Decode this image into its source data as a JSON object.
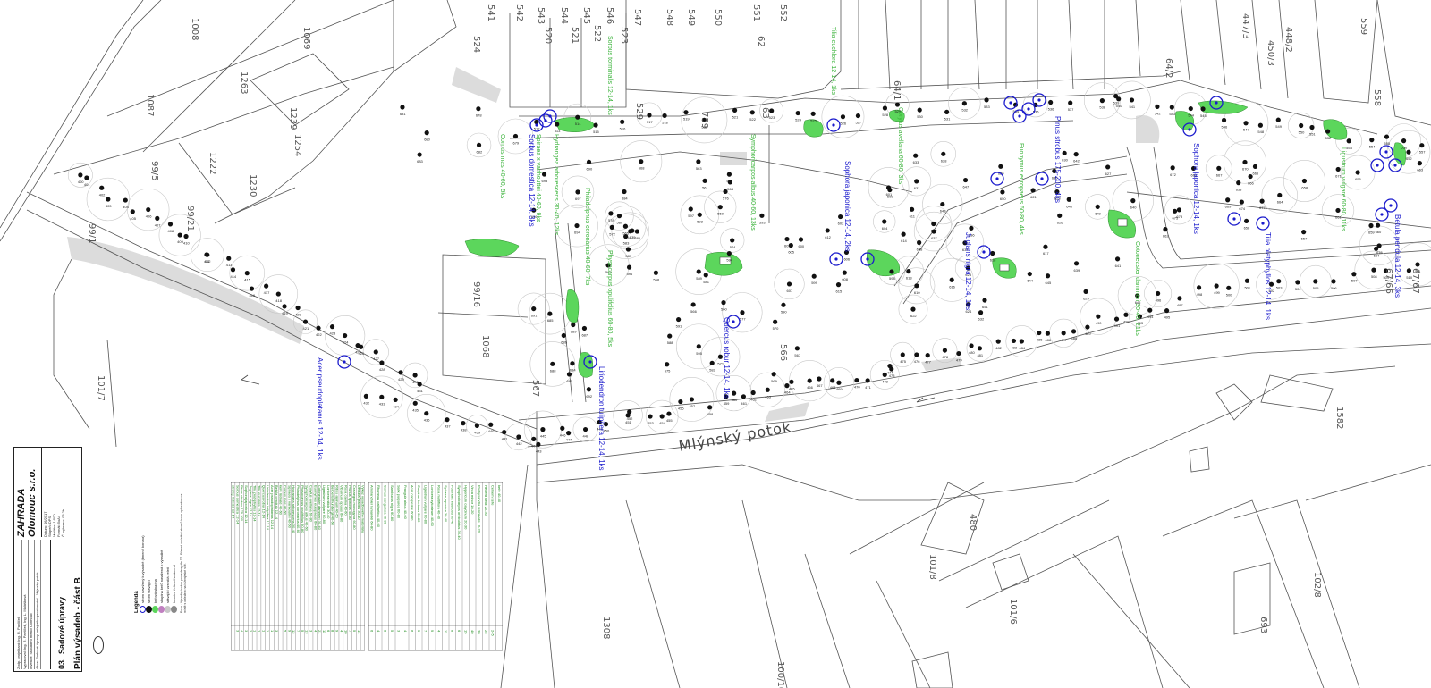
{
  "street_name": "Mlýnský potok",
  "parcels": [
    "541",
    "542",
    "543",
    "544",
    "545",
    "546",
    "547",
    "548",
    "549",
    "550",
    "551",
    "552",
    "559",
    "524",
    "520",
    "521",
    "522",
    "523",
    "529",
    "62",
    "63",
    "64/1",
    "64/2",
    "759",
    "67/66",
    "67/67",
    "99/5",
    "99/1",
    "99/21",
    "99/16",
    "1068",
    "567",
    "566",
    "1087",
    "1008",
    "1069",
    "1239",
    "1263",
    "1222",
    "1230",
    "1254",
    "1308",
    "101/7",
    "101/6",
    "100/10",
    "101/8",
    "102/8",
    "693",
    "480",
    "1582",
    "558",
    "450/3",
    "448/2",
    "447/3"
  ],
  "green_labels": [
    "Tilia euchlora 12-14, 1ks",
    "Sorbus torminalis 12-14, 1ks",
    "Cornus mas 40-60, 5ks",
    "Spiraea x vanhouttei 40-60, 9ks",
    "Hydrangea arborescens 30-40, 12ks",
    "Philadelphus coronarius 40-60, 7ks",
    "Physocarpus opulifolius 60-80, 5ks",
    "Symphoricarpos albus 40-60, 13ks",
    "Corylus avellana 60-80, 3ks",
    "Euonymus europaeus 60-80, 4ks",
    "Cotoneaster dammeri 30-40, 21ks",
    "Ligustrum vulgare 60-80, 11ks"
  ],
  "blue_labels": [
    "Sorbus domestica 12-14, 3ks",
    "Pinus strobus 175-200, 4ks",
    "Sophora japonica 12-14, 2ks",
    "Juglans nigra 12-14, 1ks",
    "Sophora japonica 12-14, 1ks",
    "Tilia platyphyllos 12-14, 1ks",
    "Quercus robur 12-14, 1ks",
    "Liriodendron tulipifera 12-14, 1ks",
    "Acer pseudoplatanus 12-14, 1ks",
    "Betula pendula 12-14, 3ks"
  ],
  "table1": {
    "header": "Výkaz výsadbového materiálu",
    "rows": [
      "stromy listnaté 12-14",
      "Sorbus domestica 12-14",
      "Pinus strobus 175-200",
      "Sophora japonica 12-14",
      "Juglans nigra 12-14",
      "Tilia platyphyllos 12-14",
      "Tilia euchlora 12-14",
      "Quercus robur 12-14",
      "Liriodendron tulipifera 12-14",
      "Acer pseudoplatanus 12-14",
      "Betula pendula 12-14",
      "keře listnaté 40-60",
      "Cornus mas 40-60",
      "Spiraea x vanhouttei 40-60",
      "Hydrangea arborescens 30-40",
      "Philadelphus coronarius 40-60",
      "Physocarpus opulifolius 60-80",
      "Symphoricarpos albus 40-60",
      "Corylus avellana 60-80",
      "Euonymus europaeus 60-80",
      "Cotoneaster dammeri 30-40",
      "Ligustrum vulgare 60-80",
      "Lonicera nitida 30-40",
      "Berberis thunbergii 40-60",
      "Ribes alpinum 40-60",
      "Viburnum opulus 60-80",
      "Rosa canina 40-60",
      "Prunus spinosa 40-60",
      "Crataegus monogyna 60-80",
      "Deutzia gracilis 30-40"
    ],
    "qty": [
      "",
      "3",
      "4",
      "3",
      "2",
      "1",
      "1",
      "1",
      "1",
      "1",
      "3",
      "",
      "5",
      "9",
      "12",
      "7",
      "5",
      "13",
      "3",
      "4",
      "21",
      "11",
      "6",
      "8",
      "9",
      "4",
      "10",
      "7",
      "5",
      "14"
    ]
  },
  "table2": {
    "header": "keře 40-60",
    "rows": [
      "Amelanchier lamarckii 60-80",
      "Rhamnus cathartica 40-60",
      "Cornus sanguinea 60-80",
      "Sambucus nigra 60-80",
      "Salix purpurea 60-80",
      "Frangula alnus 40-60",
      "Acer campestre 60-80",
      "Carpinus betulus 60-80",
      "Ligustrum vulgare 60-80",
      "Lonicera xylosteum 40-60",
      "Rosa multiflora 40-60",
      "Spiraea japonica 30-40",
      "Potentilla fruticosa 30-40",
      "Symphoricarpos orbiculatus 30-40",
      "Hypericum calycinum 20-30",
      "Vinca minor 10-20",
      "Pachysandra terminalis 10-20",
      "Hedera helix 20-30",
      "Celkem keře"
    ],
    "qty": [
      "6",
      "4",
      "8",
      "5",
      "3",
      "4",
      "6",
      "5",
      "7",
      "9",
      "4",
      "11",
      "8",
      "6",
      "15",
      "40",
      "30",
      "25",
      "245"
    ]
  },
  "legend": {
    "title": "Legenda",
    "items": [
      "strom navržený k výsadbě (kmen / koruna)",
      "strom stávající",
      "keřová skupina",
      "skupina keřů navržená k výsadbě",
      "stávající vzrostlá zeleň",
      "hranice řešeného území"
    ],
    "notes": "Pozn.: Výsadby budou provedeny dle TZ. Přesné umístění stromů bude upřesněno na místě s ohledem na inženýrské sítě."
  },
  "title_block": {
    "company": "ZAHRADA Olomouc s.r.o.",
    "rows": [
      {
        "label": "Zodp. projektant",
        "value": "Ing. R. Pavlíček"
      },
      {
        "label": "Vypracoval",
        "value": "Ing. R. Pavlíček, Ing. L. Malášková"
      },
      {
        "label": "Investor",
        "value": "Statutární město Olomouc"
      },
      {
        "label": "Akce",
        "value": "Parkové úpravy veřejného prostranství - Mlýnský potok"
      }
    ],
    "right": [
      {
        "label": "Datum",
        "value": "06/2017"
      },
      {
        "label": "Stupeň",
        "value": "DPS"
      },
      {
        "label": "Měřítko",
        "value": "1:500"
      },
      {
        "label": "Formát",
        "value": "5xA4"
      },
      {
        "label": "Č. výkresu",
        "value": "03.2b"
      }
    ],
    "drawing_no": "03.",
    "drawing_title": "Sadové úpravy",
    "drawing_subtitle": "Plán výsadeb - část B"
  },
  "colors": {
    "green": "#3bb33b",
    "blue": "#1a1acc",
    "shrub_fill": "#5cd65c",
    "gray_zone": "#dcdcdc",
    "line": "#555555"
  }
}
